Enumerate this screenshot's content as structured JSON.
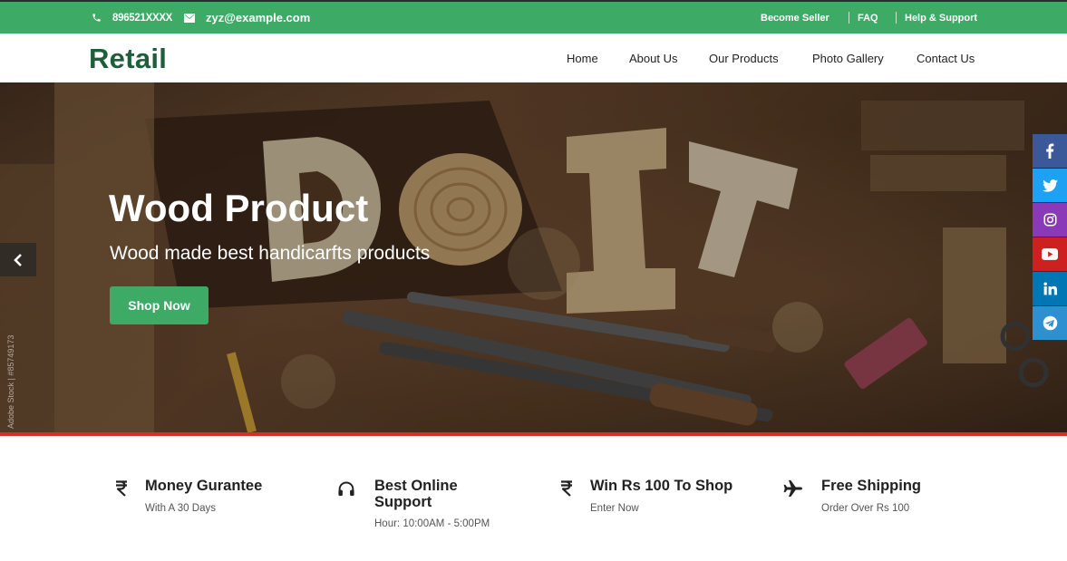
{
  "topbar": {
    "phone": "896521XXXX",
    "email": "zyz@example.com",
    "links": [
      "Become Seller",
      "FAQ",
      "Help & Support"
    ]
  },
  "nav": {
    "logo": "Retail",
    "items": [
      "Home",
      "About Us",
      "Our Products",
      "Photo Gallery",
      "Contact Us"
    ]
  },
  "hero": {
    "title": "Wood Product",
    "subtitle": "Wood made best handicarfts products",
    "cta": "Shop Now",
    "watermark": "Adobe Stock | #85749173"
  },
  "social": [
    {
      "icon": "facebook-icon",
      "color": "#3b5998"
    },
    {
      "icon": "twitter-icon",
      "color": "#1da1f2"
    },
    {
      "icon": "instagram-icon",
      "color": "#8a3ab9"
    },
    {
      "icon": "youtube-icon",
      "color": "#cd201f"
    },
    {
      "icon": "linkedin-icon",
      "color": "#0077b5"
    },
    {
      "icon": "telegram-icon",
      "color": "#2e8fd1"
    }
  ],
  "features": [
    {
      "icon": "rupee-icon",
      "title": "Money Gurantee",
      "subtitle": "With A 30 Days"
    },
    {
      "icon": "headphones-icon",
      "title": "Best Online Support",
      "title_line1": "Best Online",
      "title_line2": "Support",
      "subtitle": "Hour: 10:00AM - 5:00PM"
    },
    {
      "icon": "rupee-icon",
      "title": "Win Rs 100 To Shop",
      "subtitle": "Enter Now"
    },
    {
      "icon": "airplane-icon",
      "title": "Free Shipping",
      "subtitle": "Order Over Rs 100"
    }
  ],
  "colors": {
    "brand_green": "#3daa66",
    "logo_green": "#1f5e3a",
    "accent_red": "#d3302c"
  }
}
